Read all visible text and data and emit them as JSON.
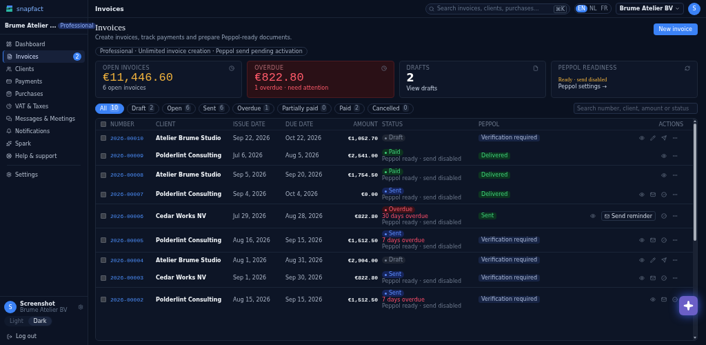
{
  "sidebar": {
    "logo": "snapfact",
    "org": {
      "name": "Brume Atelier ...",
      "plan": "Professional"
    },
    "items": [
      {
        "label": "Dashboard",
        "selected": false
      },
      {
        "label": "Invoices",
        "selected": true,
        "badge": "2"
      },
      {
        "label": "Clients",
        "selected": false
      },
      {
        "label": "Payments",
        "selected": false
      },
      {
        "label": "Purchases",
        "selected": false
      },
      {
        "label": "VAT & Taxes",
        "selected": false
      },
      {
        "label": "Messages & Meetings",
        "selected": false
      },
      {
        "label": "Notifications",
        "selected": false
      },
      {
        "label": "Spark",
        "selected": false
      },
      {
        "label": "Help & support",
        "selected": false
      }
    ],
    "settings": {
      "label": "Settings",
      "selected": false
    },
    "user": {
      "avatar": "S",
      "name": "Screenshot",
      "org": "Brume Atelier BV"
    },
    "theme": [
      {
        "label": "Light",
        "selected": false
      },
      {
        "label": "Dark",
        "selected": true
      }
    ],
    "logout": "Log out"
  },
  "header": {
    "title": "Invoices",
    "search": {
      "placeholder": "Search invoices, clients, purchases...",
      "shortcut": "⌘K"
    },
    "languages": [
      {
        "label": "EN",
        "selected": true
      },
      {
        "label": "NL",
        "selected": false
      },
      {
        "label": "FR",
        "selected": false
      }
    ],
    "company": "Brume Atelier BV",
    "avatar": "S"
  },
  "page": {
    "title": "Invoices",
    "subtitle": "Create invoices, track payments and prepare Peppol-ready documents.",
    "plan_note": "Professional · Unlimited invoice creation · Peppol send pending activation",
    "new_button": "New invoice"
  },
  "cards": [
    {
      "kind": "open",
      "label": "OPEN INVOICES",
      "value": "€11,446.60",
      "note": "6 open invoices"
    },
    {
      "kind": "overdue",
      "label": "OVERDUE",
      "value": "€822.80",
      "note": "1 overdue · need attention"
    },
    {
      "kind": "drafts",
      "label": "DRAFTS",
      "value": "2",
      "note": "View drafts"
    },
    {
      "kind": "peppol",
      "label": "PEPPOL READINESS",
      "value": "Ready · send disabled",
      "note": "Peppol settings →"
    }
  ],
  "filters": [
    {
      "label": "All",
      "count": "10",
      "selected": true
    },
    {
      "label": "Draft",
      "count": "2",
      "selected": false
    },
    {
      "label": "Open",
      "count": "6",
      "selected": false
    },
    {
      "label": "Sent",
      "count": "6",
      "selected": false
    },
    {
      "label": "Overdue",
      "count": "1",
      "selected": false
    },
    {
      "label": "Partially paid",
      "count": "0",
      "selected": false
    },
    {
      "label": "Paid",
      "count": "2",
      "selected": false
    },
    {
      "label": "Cancelled",
      "count": "0",
      "selected": false
    }
  ],
  "table_search": {
    "placeholder": "Search number, client, amount or status"
  },
  "table": {
    "select_all_checked": false,
    "columns": [
      "NUMBER",
      "CLIENT",
      "ISSUE DATE",
      "DUE DATE",
      "AMOUNT",
      "STATUS",
      "PEPPOL",
      "ACTIONS"
    ],
    "rows": [
      {
        "checked": false,
        "number": "2026-00010",
        "client": "Atelier Brume Studio",
        "issue": "Sep 22, 2026",
        "due": "Oct 22, 2026",
        "amount": "€1,052.70",
        "status": {
          "kind": "draft",
          "label": "Draft"
        },
        "peppol": {
          "kind": "pending",
          "label": "Verification required"
        },
        "actions": [
          {
            "kind": "view"
          },
          {
            "kind": "edit"
          },
          {
            "kind": "send"
          },
          {
            "kind": "more"
          }
        ]
      },
      {
        "checked": false,
        "number": "2026-00009",
        "client": "Polderlint Consulting",
        "issue": "Jul 6, 2026",
        "due": "Aug 5, 2026",
        "amount": "€2,541.00",
        "status": {
          "kind": "paid",
          "label": "Paid"
        },
        "note": "Peppol ready · send disabled",
        "peppol": {
          "kind": "delivered",
          "label": "Delivered"
        },
        "actions": [
          {
            "kind": "view"
          },
          {
            "kind": "more"
          }
        ]
      },
      {
        "checked": false,
        "number": "2026-00008",
        "client": "Atelier Brume Studio",
        "issue": "Sep 5, 2026",
        "due": "Sep 20, 2026",
        "amount": "€1,754.50",
        "status": {
          "kind": "paid",
          "label": "Paid"
        },
        "note": "Peppol ready · send disabled",
        "peppol": {
          "kind": "delivered",
          "label": "Delivered"
        },
        "actions": [
          {
            "kind": "view"
          },
          {
            "kind": "more"
          }
        ]
      },
      {
        "checked": false,
        "number": "2026-00007",
        "client": "Polderlint Consulting",
        "issue": "Sep 4, 2026",
        "due": "Oct 4, 2026",
        "amount": "€0.00",
        "status": {
          "kind": "sent",
          "label": "Sent"
        },
        "note": "Peppol ready · send disabled",
        "peppol": {
          "kind": "delivered",
          "label": "Delivered"
        },
        "actions": [
          {
            "kind": "view"
          },
          {
            "kind": "mail"
          },
          {
            "kind": "check"
          },
          {
            "kind": "more"
          }
        ]
      },
      {
        "checked": false,
        "number": "2026-00006",
        "client": "Cedar Works NV",
        "issue": "Jul 29, 2026",
        "due": "Aug 28, 2026",
        "amount": "€822.80",
        "status": {
          "kind": "overdue",
          "label": "Overdue"
        },
        "overdue_note": "30 days overdue",
        "note": "Peppol ready · send disabled",
        "peppol": {
          "kind": "delivered",
          "label": "Sent"
        },
        "actions": [
          {
            "kind": "view"
          },
          {
            "kind": "remind",
            "label": "Send reminder"
          },
          {
            "kind": "check"
          },
          {
            "kind": "more"
          }
        ]
      },
      {
        "checked": false,
        "number": "2026-00005",
        "client": "Polderlint Consulting",
        "issue": "Aug 16, 2026",
        "due": "Sep 15, 2026",
        "amount": "€1,512.50",
        "status": {
          "kind": "sent",
          "label": "Sent"
        },
        "overdue_note": "7 days overdue",
        "note": "Peppol ready · send disabled",
        "peppol": {
          "kind": "pending",
          "label": "Verification required"
        },
        "actions": [
          {
            "kind": "view"
          },
          {
            "kind": "mail"
          },
          {
            "kind": "check"
          },
          {
            "kind": "more"
          }
        ]
      },
      {
        "checked": false,
        "number": "2026-00004",
        "client": "Atelier Brume Studio",
        "issue": "Aug 1, 2026",
        "due": "Aug 31, 2026",
        "amount": "€2,904.00",
        "status": {
          "kind": "draft",
          "label": "Draft"
        },
        "peppol": {
          "kind": "pending",
          "label": "Verification required"
        },
        "actions": [
          {
            "kind": "view"
          },
          {
            "kind": "edit"
          },
          {
            "kind": "send"
          },
          {
            "kind": "more"
          }
        ]
      },
      {
        "checked": false,
        "number": "2026-00003",
        "client": "Cedar Works NV",
        "issue": "Sep 1, 2026",
        "due": "Sep 30, 2026",
        "amount": "€822.80",
        "status": {
          "kind": "sent",
          "label": "Sent"
        },
        "note": "Peppol ready · send disabled",
        "peppol": {
          "kind": "pending",
          "label": "Verification required"
        },
        "actions": [
          {
            "kind": "view"
          },
          {
            "kind": "mail"
          },
          {
            "kind": "check"
          },
          {
            "kind": "more"
          }
        ]
      },
      {
        "checked": false,
        "number": "2026-00002",
        "client": "Polderlint Consulting",
        "issue": "Aug 15, 2026",
        "due": "Sep 15, 2026",
        "amount": "€1,512.50",
        "status": {
          "kind": "sent",
          "label": "Sent"
        },
        "overdue_note": "7 days overdue",
        "note": "Peppol ready · send disabled",
        "peppol": {
          "kind": "pending",
          "label": "Verification required"
        },
        "actions": [
          {
            "kind": "view"
          },
          {
            "kind": "mail"
          },
          {
            "kind": "check"
          }
        ]
      }
    ]
  }
}
